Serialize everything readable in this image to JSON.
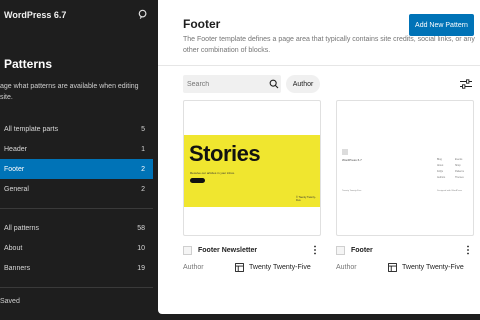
{
  "sidebar": {
    "title": "WordPress 6.7",
    "heading": "Patterns",
    "desc_line1": "age what patterns are available when editing",
    "desc_line2": "site.",
    "items": [
      {
        "label": "All template parts",
        "count": "5"
      },
      {
        "label": "Header",
        "count": "1"
      },
      {
        "label": "Footer",
        "count": "2"
      },
      {
        "label": "General",
        "count": "2"
      },
      {
        "label": "All patterns",
        "count": "58"
      },
      {
        "label": "About",
        "count": "10"
      },
      {
        "label": "Banners",
        "count": "19"
      }
    ],
    "active_item": "Footer",
    "status": "Saved"
  },
  "main": {
    "title": "Footer",
    "description": "The Footer template defines a page area that typically contains site credits, social links, or any other combination of blocks.",
    "add_button": "Add New Pattern",
    "search_placeholder": "Search",
    "author_filter": "Author",
    "cards": [
      {
        "name": "Footer Newsletter",
        "author_label": "Author",
        "theme": "Twenty Twenty-Five",
        "preview": {
          "headline": "Stories",
          "subtext": "Receive our articles in your inbox.",
          "button": "Subscribe",
          "right_text": "© Twenty Twenty-Five"
        }
      },
      {
        "name": "Footer",
        "author_label": "Author",
        "theme": "Twenty Twenty-Five",
        "preview": {
          "site_title": "WordPress 6.7",
          "links_col1": [
            "Blog",
            "About",
            "FAQs",
            "Authors"
          ],
          "links_col2": [
            "Events",
            "Shop",
            "Patterns",
            "Themes"
          ],
          "bottom_left": "Twenty Twenty-Five",
          "bottom_right": "Designed with WordPress"
        }
      }
    ]
  },
  "colors": {
    "accent": "#0073b7",
    "sidebar_bg": "#1e1e1e",
    "stories_yellow": "#f0e62f"
  }
}
